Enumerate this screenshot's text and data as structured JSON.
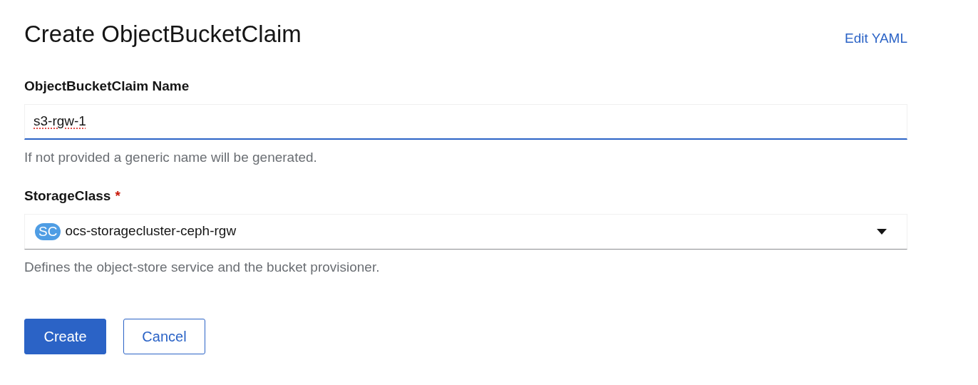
{
  "page": {
    "title": "Create ObjectBucketClaim",
    "edit_link": "Edit YAML"
  },
  "fields": [
    {
      "kind": "text",
      "label": "ObjectBucketClaim Name",
      "value": "s3-rgw-1",
      "focused": true,
      "helper": "If not provided a generic name will be generated."
    },
    {
      "kind": "select",
      "label": "StorageClass",
      "required_mark": "*",
      "badge": "SC",
      "value": "ocs-storagecluster-ceph-rgw",
      "focused": false,
      "helper": "Defines the object-store service and the bucket provisioner."
    }
  ],
  "buttons": [
    {
      "label": "Create",
      "kind": "primary"
    },
    {
      "label": "Cancel",
      "kind": "secondary"
    }
  ]
}
